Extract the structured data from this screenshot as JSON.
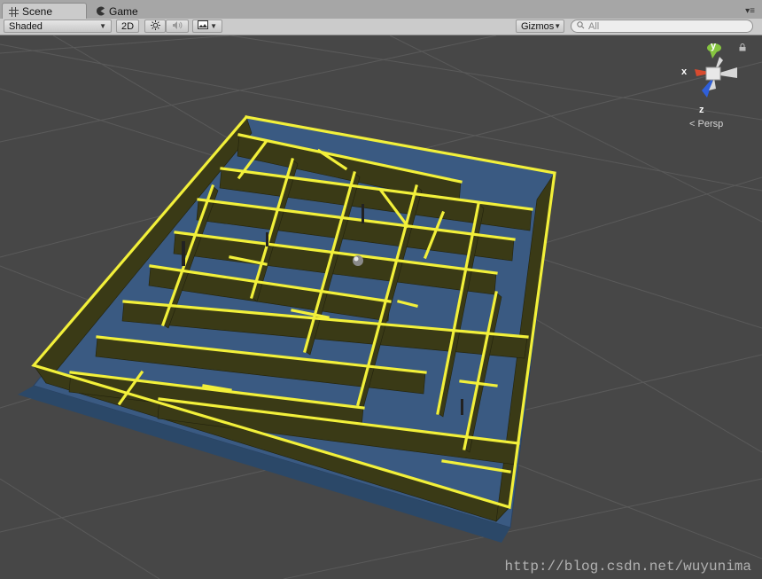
{
  "tabs": [
    {
      "label": "Scene",
      "icon": "grid-icon",
      "active": true
    },
    {
      "label": "Game",
      "icon": "pacman-icon",
      "active": false
    }
  ],
  "toolbar": {
    "render_mode": "Shaded",
    "mode_2d": "2D",
    "gizmos": "Gizmos",
    "search_placeholder": "All"
  },
  "gizmo": {
    "axis_x": "x",
    "axis_y": "y",
    "axis_z": "z",
    "projection": "Persp",
    "colors": {
      "x": "#d84a2e",
      "y": "#86c540",
      "z": "#2f5fd9"
    }
  },
  "watermark": "http://blog.csdn.net/wuyunima",
  "colors": {
    "viewport_bg": "#474747",
    "wall_top": "#f2f03a",
    "wall_face": "#3a3a16",
    "floor": "#3a5a82"
  }
}
